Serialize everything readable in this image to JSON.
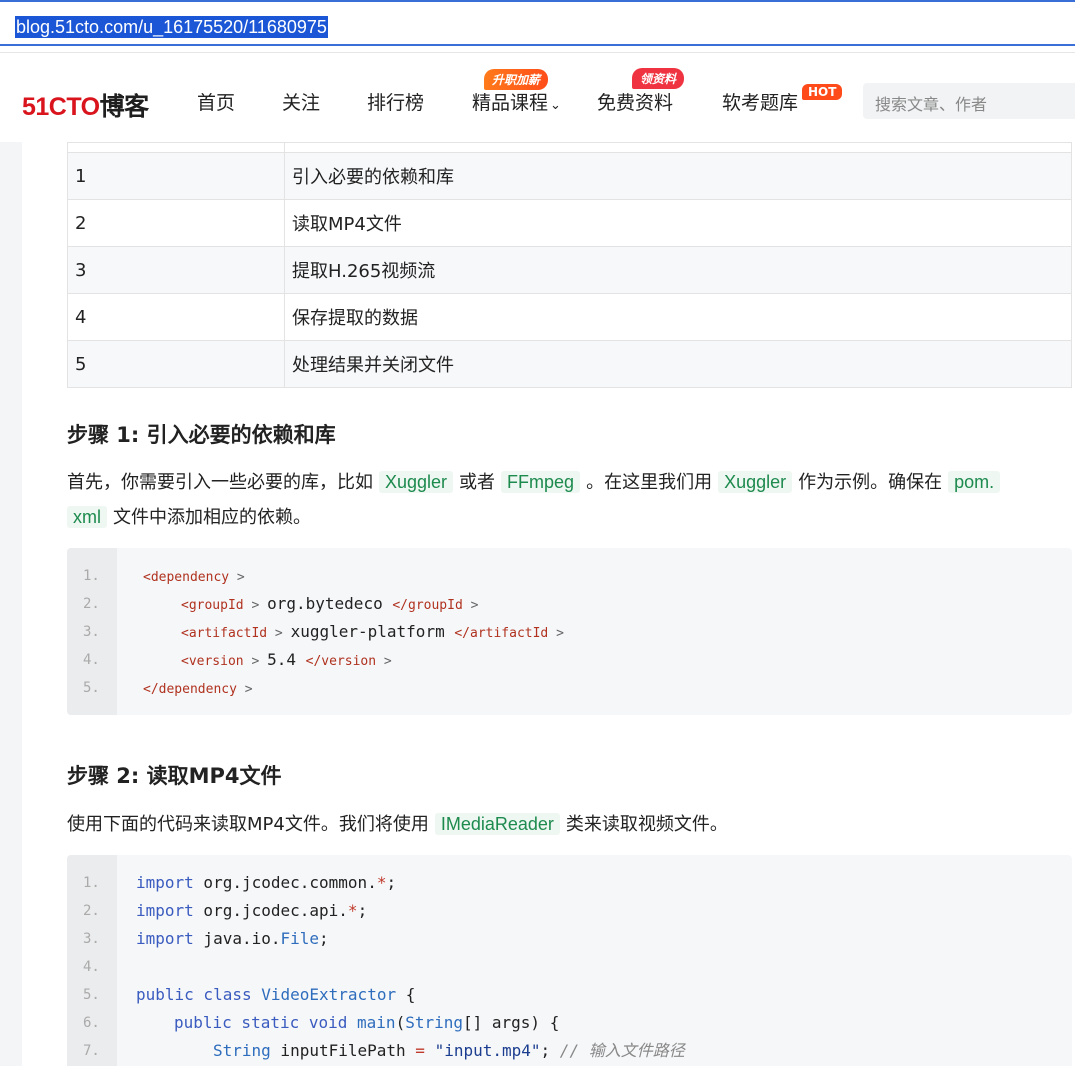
{
  "browser": {
    "url": "blog.51cto.com/u_16175520/11680975"
  },
  "header": {
    "logo_part1": "51CTO",
    "logo_part2": "博客",
    "nav": {
      "home": "首页",
      "follow": "关注",
      "ranking": "排行榜",
      "courses": "精品课程",
      "free": "免费资料",
      "exam": "软考题库"
    },
    "badges": {
      "courses": "升职加薪",
      "free": "领资料",
      "exam": "HOT"
    },
    "search_placeholder": "搜索文章、作者"
  },
  "steps_table": {
    "rows": [
      {
        "num": "1",
        "text": "引入必要的依赖和库"
      },
      {
        "num": "2",
        "text": "读取MP4文件"
      },
      {
        "num": "3",
        "text": "提取H.265视频流"
      },
      {
        "num": "4",
        "text": "保存提取的数据"
      },
      {
        "num": "5",
        "text": "处理结果并关闭文件"
      }
    ]
  },
  "step1": {
    "heading": "步骤 1: 引入必要的依赖和库",
    "p_a": "首先，你需要引入一些必要的库，比如",
    "code_a": "Xuggler",
    "p_b": "或者",
    "code_b": "FFmpeg",
    "p_c": "。在这里我们用",
    "code_c": "Xuggler",
    "p_d": "作为示例。确保在",
    "code_d1": "pom.",
    "code_d2": "xml",
    "p_e": "文件中添加相应的依赖。",
    "code_lines": [
      {
        "n": "1.",
        "indent": "",
        "open": "<dependency",
        "value": "",
        "close": ""
      },
      {
        "n": "2.",
        "indent": "    ",
        "open": "<groupId",
        "value": "org.bytedeco",
        "close": "</groupId"
      },
      {
        "n": "3.",
        "indent": "    ",
        "open": "<artifactId",
        "value": "xuggler-platform",
        "close": "</artifactId"
      },
      {
        "n": "4.",
        "indent": "    ",
        "open": "<version",
        "value": "5.4",
        "close": "</version"
      },
      {
        "n": "5.",
        "indent": "",
        "open": "</dependency",
        "value": "",
        "close": ""
      }
    ]
  },
  "step2": {
    "heading": "步骤 2: 读取MP4文件",
    "p_a": "使用下面的代码来读取MP4文件。我们将使用",
    "code_a": "IMediaReader",
    "p_b": "类来读取视频文件。",
    "line_numbers": [
      "1.",
      "2.",
      "3.",
      "4.",
      "5.",
      "6.",
      "7."
    ],
    "l1_kw": "import",
    "l1_pkg": " org.jcodec.common.",
    "l1_star": "*",
    "l1_end": ";",
    "l2_kw": "import",
    "l2_pkg": " org.jcodec.api.",
    "l2_star": "*",
    "l2_end": ";",
    "l3_kw": "import",
    "l3_pkg": " java.io.",
    "l3_cls": "File",
    "l3_end": ";",
    "l5_kw": "public class",
    "l5_name": " VideoExtractor",
    "l5_end": " {",
    "l6_kw": "public static void",
    "l6_name": " main",
    "l6_open": "(",
    "l6_type": "String",
    "l6_rest": "[] args) {",
    "l7_type": "String",
    "l7_var": " inputFilePath ",
    "l7_eq": "=",
    "l7_str": " \"input.mp4\"",
    "l7_semi": ";",
    "l7_cmt": " // 输入文件路径"
  }
}
